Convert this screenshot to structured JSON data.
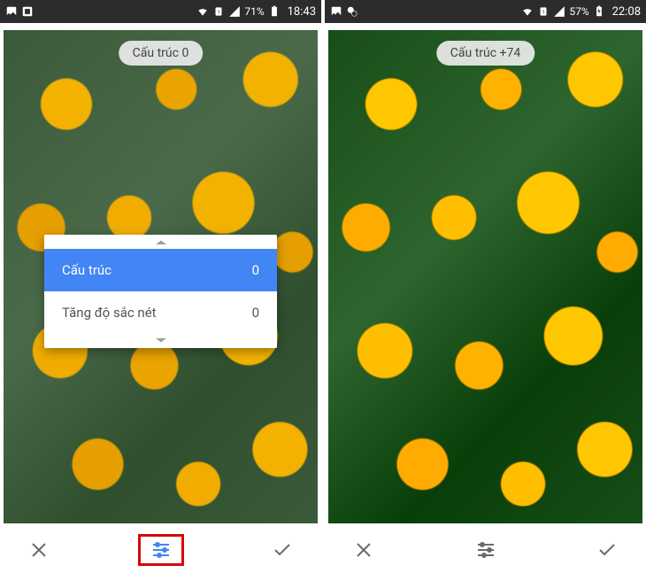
{
  "left_screen": {
    "status": {
      "battery_pct": "71%",
      "time": "18:43"
    },
    "badge_text": "Cấu trúc 0",
    "popup": {
      "row_active": {
        "label": "Cấu trúc",
        "value": "0"
      },
      "row_inactive": {
        "label": "Tăng độ sắc nét",
        "value": "0"
      }
    }
  },
  "right_screen": {
    "status": {
      "battery_pct": "57%",
      "time": "22:08"
    },
    "badge_text": "Cấu trúc +74"
  }
}
